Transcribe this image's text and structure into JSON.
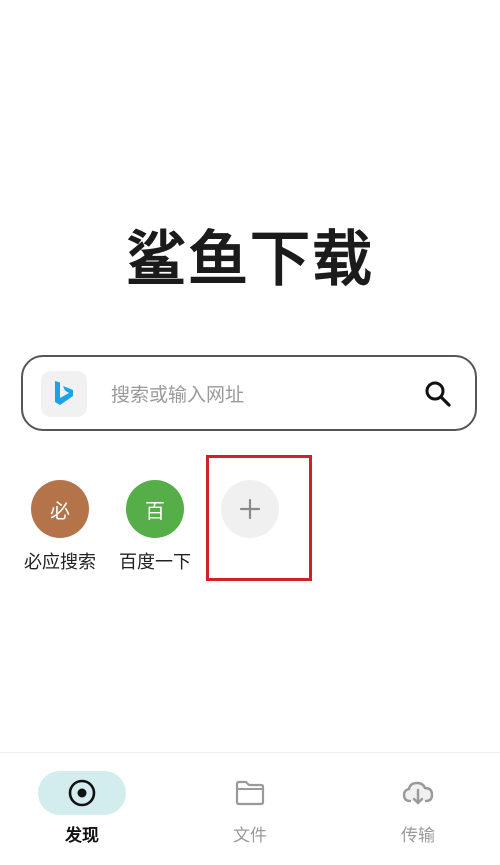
{
  "header": {
    "app_title": "鲨鱼下载"
  },
  "search": {
    "engine_name": "Bing",
    "placeholder": "搜索或输入网址"
  },
  "shortcuts": [
    {
      "icon_text": "必",
      "label": "必应搜索",
      "color": "#b5734a"
    },
    {
      "icon_text": "百",
      "label": "百度一下",
      "color": "#55ae47"
    }
  ],
  "add_shortcut": {
    "icon": "plus-icon",
    "highlight_color": "#d0212a"
  },
  "bottom_nav": {
    "items": [
      {
        "label": "发现",
        "icon": "discover-icon",
        "active": true
      },
      {
        "label": "文件",
        "icon": "folder-icon",
        "active": false
      },
      {
        "label": "传输",
        "icon": "cloud-download-icon",
        "active": false
      }
    ]
  },
  "colors": {
    "accent_bg": "#d3ecee",
    "bing_blue": "#1aa3e8",
    "inactive": "#9a9a9a"
  }
}
